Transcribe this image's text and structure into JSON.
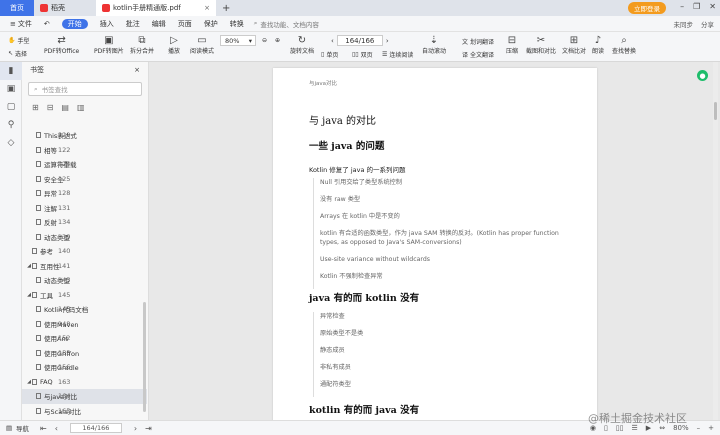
{
  "tabs": [
    {
      "label": "首页"
    },
    {
      "label": "稻壳"
    },
    {
      "label": "kotlin手册精通版.pdf"
    }
  ],
  "titlebar": {
    "login_label": "立即登录"
  },
  "menu": {
    "file_label": "文件",
    "items": [
      "开始",
      "插入",
      "批注",
      "编辑",
      "页面",
      "保护",
      "转换"
    ],
    "search_placeholder": "查找功能、文档内容",
    "right": [
      "未同步",
      "分享"
    ]
  },
  "toolbar": {
    "hand_label": "手型",
    "select_label": "选择",
    "pdf_office": "PDF转Office",
    "pdf_image": "PDF转图片",
    "split_merge": "拆分合并",
    "play": "播放",
    "read_mode": "阅读模式",
    "zoom": "80%",
    "rotate": "旋转文档",
    "single": "单页",
    "double": "双页",
    "continuous": "连续阅读",
    "auto_scroll": "自动滚动",
    "translate_label": "划词翻译",
    "full_translate": "全文翻译",
    "compress": "压缩",
    "screenshot": "截图和对比",
    "compare": "文档比对",
    "read_aloud": "朗读",
    "find_replace": "查找替换",
    "page_current": "164/166"
  },
  "sidebar": {
    "title": "书签",
    "search_placeholder": "书签查找",
    "items": [
      {
        "label": "This表达式",
        "page": "120",
        "indent": 1
      },
      {
        "label": "相等",
        "page": "122",
        "indent": 1
      },
      {
        "label": "运算符重载",
        "page": "124",
        "indent": 1
      },
      {
        "label": "安全全",
        "page": "125",
        "indent": 1
      },
      {
        "label": "异常",
        "page": "128",
        "indent": 1
      },
      {
        "label": "注解",
        "page": "131",
        "indent": 1
      },
      {
        "label": "反射",
        "page": "134",
        "indent": 1
      },
      {
        "label": "动态类型",
        "page": "139",
        "indent": 1
      },
      {
        "label": "参考",
        "page": "140",
        "indent": 0
      },
      {
        "label": "互用性",
        "page": "141",
        "indent": 0,
        "expanded": true
      },
      {
        "label": "动态类型",
        "page": "143",
        "indent": 1
      },
      {
        "label": "工具",
        "page": "145",
        "indent": 0,
        "expanded": true
      },
      {
        "label": "Kotlin代码文档",
        "page": "145",
        "indent": 1
      },
      {
        "label": "使用Maven",
        "page": "148",
        "indent": 1
      },
      {
        "label": "使用Ant",
        "page": "152",
        "indent": 1
      },
      {
        "label": "使用Griffon",
        "page": "155",
        "indent": 1
      },
      {
        "label": "使用Gradle",
        "page": "156",
        "indent": 1
      },
      {
        "label": "FAQ",
        "page": "163",
        "indent": 0,
        "expanded": true
      },
      {
        "label": "与java对比",
        "page": "164",
        "indent": 1,
        "selected": true
      },
      {
        "label": "与Scala对比",
        "page": "165",
        "indent": 1
      }
    ]
  },
  "document": {
    "running_header": "与java对比",
    "title": "与 java 的对比",
    "section1": "一些 java 的问题",
    "intro": "Kotlin 修复了 java 的一系列问题",
    "list1": [
      "Null 引用交给了类型系统控制",
      "没有 raw 类型",
      "Arrays 在 kotlin 中是不变的",
      "kotlin 有合适的函数类型，作为 java SAM 转换的反对。(Kotlin has proper function types, as opposed to Java's SAM-conversions)",
      "Use-site variance without wildcards",
      "Kotlin 不强制检查异常"
    ],
    "section2": "java 有的而 kotlin 没有",
    "list2": [
      "异常检查",
      "原始类型不是类",
      "静态成员",
      "非私有成员",
      "通配符类型"
    ],
    "section3": "kotlin 有的而 java 没有"
  },
  "status": {
    "nav_label": "导航",
    "page": "164/166",
    "zoom": "80%"
  },
  "watermark": "@稀土掘金技术社区"
}
